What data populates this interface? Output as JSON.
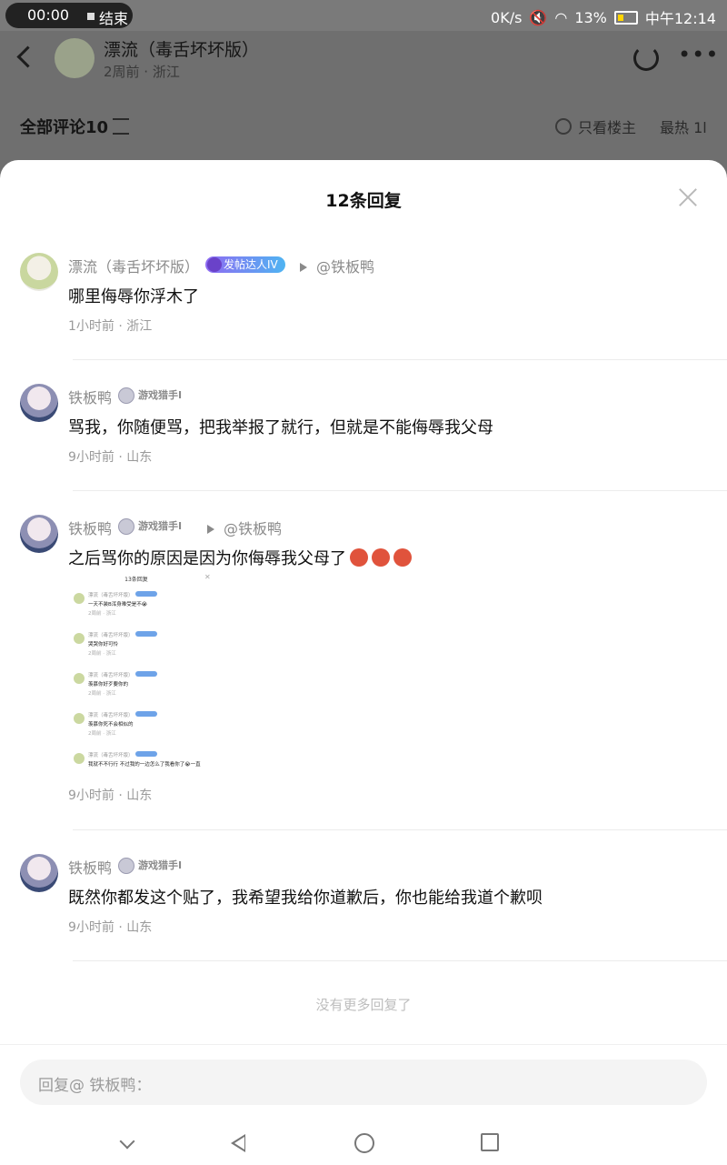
{
  "statusbar": {
    "recording_time": "00:00",
    "end_label": "结束",
    "net_speed": "0K/s",
    "battery": "13%",
    "clock": "中午12:14"
  },
  "header": {
    "title": "漂流（毒舌坏坏版）",
    "subtitle": "2周前 · 浙江"
  },
  "comments_bar": {
    "title": "全部评论10",
    "only_owner": "只看楼主",
    "sort": "最热 1l"
  },
  "sheet": {
    "title": "12条回复",
    "replies": [
      {
        "name": "漂流（毒舌坏坏版）",
        "badge": "发帖达人IV",
        "reply_to": "@铁板鸭",
        "content": "哪里侮辱你浮木了",
        "meta": "1小时前 · 浙江"
      },
      {
        "name": "铁板鸭",
        "badge": "游戏猎手I",
        "reply_to": "",
        "content": "骂我，你随便骂，把我举报了就行，但就是不能侮辱我父母",
        "meta": "9小时前 · 山东"
      },
      {
        "name": "铁板鸭",
        "badge": "游戏猎手I",
        "reply_to": "@铁板鸭",
        "content": "之后骂你的原因是因为你侮辱我父母了",
        "meta": "9小时前 · 山东",
        "embedded_image": {
          "title": "13条回复",
          "items": [
            {
              "name": "漂流（毒舌坏坏版）",
              "text": "一天不装B浑身难受是不😭",
              "time": "2周前 · 浙江"
            },
            {
              "name": "漂流（毒舌坏坏版）",
              "text": "哭哭你好可怜",
              "time": "2周前 · 浙江"
            },
            {
              "name": "漂流（毒舌坏坏版）",
              "text": "羡慕你好歹要你的",
              "time": "2周前 · 浙江"
            },
            {
              "name": "漂流（毒舌坏坏版）",
              "text": "羡慕你死不会相似的",
              "time": "2周前 · 浙江"
            },
            {
              "name": "漂流（毒舌坏坏版）",
              "text": "我就不不行行 不过我的一边怎么了我看你了😭一直",
              "time": ""
            }
          ]
        }
      },
      {
        "name": "铁板鸭",
        "badge": "游戏猎手I",
        "reply_to": "",
        "content": "既然你都发这个贴了，我希望我给你道歉后，你也能给我道个歉呗",
        "meta": "9小时前 · 山东"
      }
    ],
    "no_more": "没有更多回复了",
    "input_placeholder": "回复@ 铁板鸭："
  }
}
